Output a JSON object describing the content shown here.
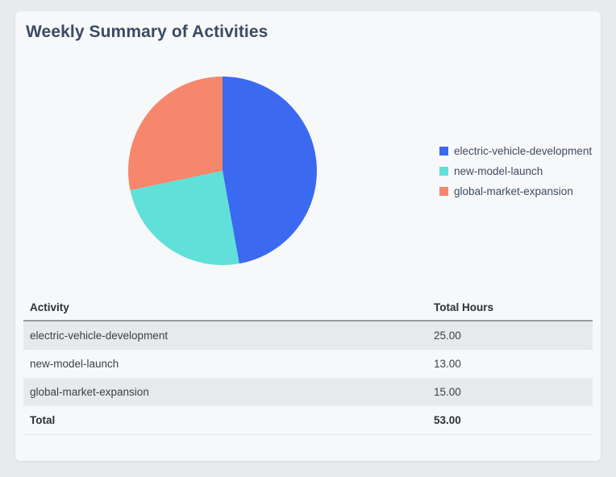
{
  "card": {
    "title": "Weekly Summary of Activities"
  },
  "chart_data": {
    "type": "pie",
    "categories": [
      "electric-vehicle-development",
      "new-model-launch",
      "global-market-expansion"
    ],
    "values": [
      25,
      13,
      15
    ],
    "total": 53,
    "colors": [
      "#3b69f0",
      "#60e0d9",
      "#f6876c"
    ],
    "start_angle_deg": 0,
    "direction": "clockwise",
    "legend_position": "right",
    "title": "Weekly Summary of Activities"
  },
  "table": {
    "headers": [
      "Activity",
      "Total Hours"
    ],
    "rows": [
      {
        "activity": "electric-vehicle-development",
        "hours": "25.00"
      },
      {
        "activity": "new-model-launch",
        "hours": "13.00"
      },
      {
        "activity": "global-market-expansion",
        "hours": "15.00"
      }
    ],
    "total_row": {
      "label": "Total",
      "hours": "53.00"
    }
  },
  "colors": {
    "page_background": "#e9eaed",
    "card_background": "#f7f8f9",
    "title_text": "#3b4a64",
    "stripe": "#e7e9ea",
    "header_border": "#989ca1"
  }
}
